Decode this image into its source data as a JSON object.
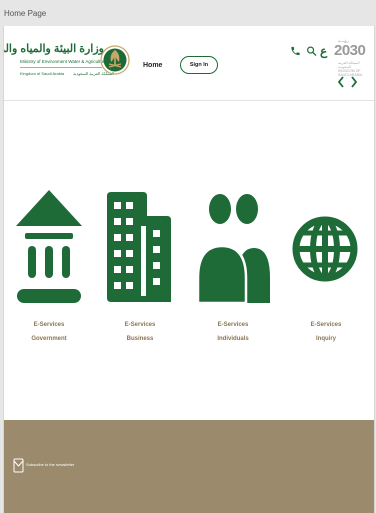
{
  "window": {
    "title": "Home Page"
  },
  "header": {
    "ministry_name_ar": "وزارة البيئة والمياه والزراعة",
    "ministry_name_en": "Ministry of Environment Water & Agriculture",
    "kingdom_en": "Kingdom of Saudi Arabia",
    "kingdom_ar": "المملكة العربية السعودية",
    "nav_home": "Home",
    "sign_in": "Sign In",
    "language_toggle": "ع",
    "vision_label": "رؤيـــة",
    "vision_year": "2030",
    "vision_sub": "المملكة العربية السعودية KINGDOM OF SAUDI ARABIA"
  },
  "icons": {
    "phone": "phone-icon",
    "search": "search-icon",
    "prev": "chevron-left-icon",
    "next": "chevron-right-icon",
    "mail": "mail-icon"
  },
  "services": [
    {
      "line1": "E-Services",
      "line2": "Government",
      "icon": "government-building-icon"
    },
    {
      "line1": "E-Services",
      "line2": "Business",
      "icon": "business-building-icon"
    },
    {
      "line1": "E-Services",
      "line2": "Individuals",
      "icon": "individuals-icon"
    },
    {
      "line1": "E-Services",
      "line2": "Inquiry",
      "icon": "globe-icon"
    }
  ],
  "footer": {
    "newsletter": "Subscribe to the newsletter"
  },
  "colors": {
    "brand_green": "#1e6b38",
    "footer_bg": "#9b8a6c",
    "label_brown": "#8a7555"
  }
}
